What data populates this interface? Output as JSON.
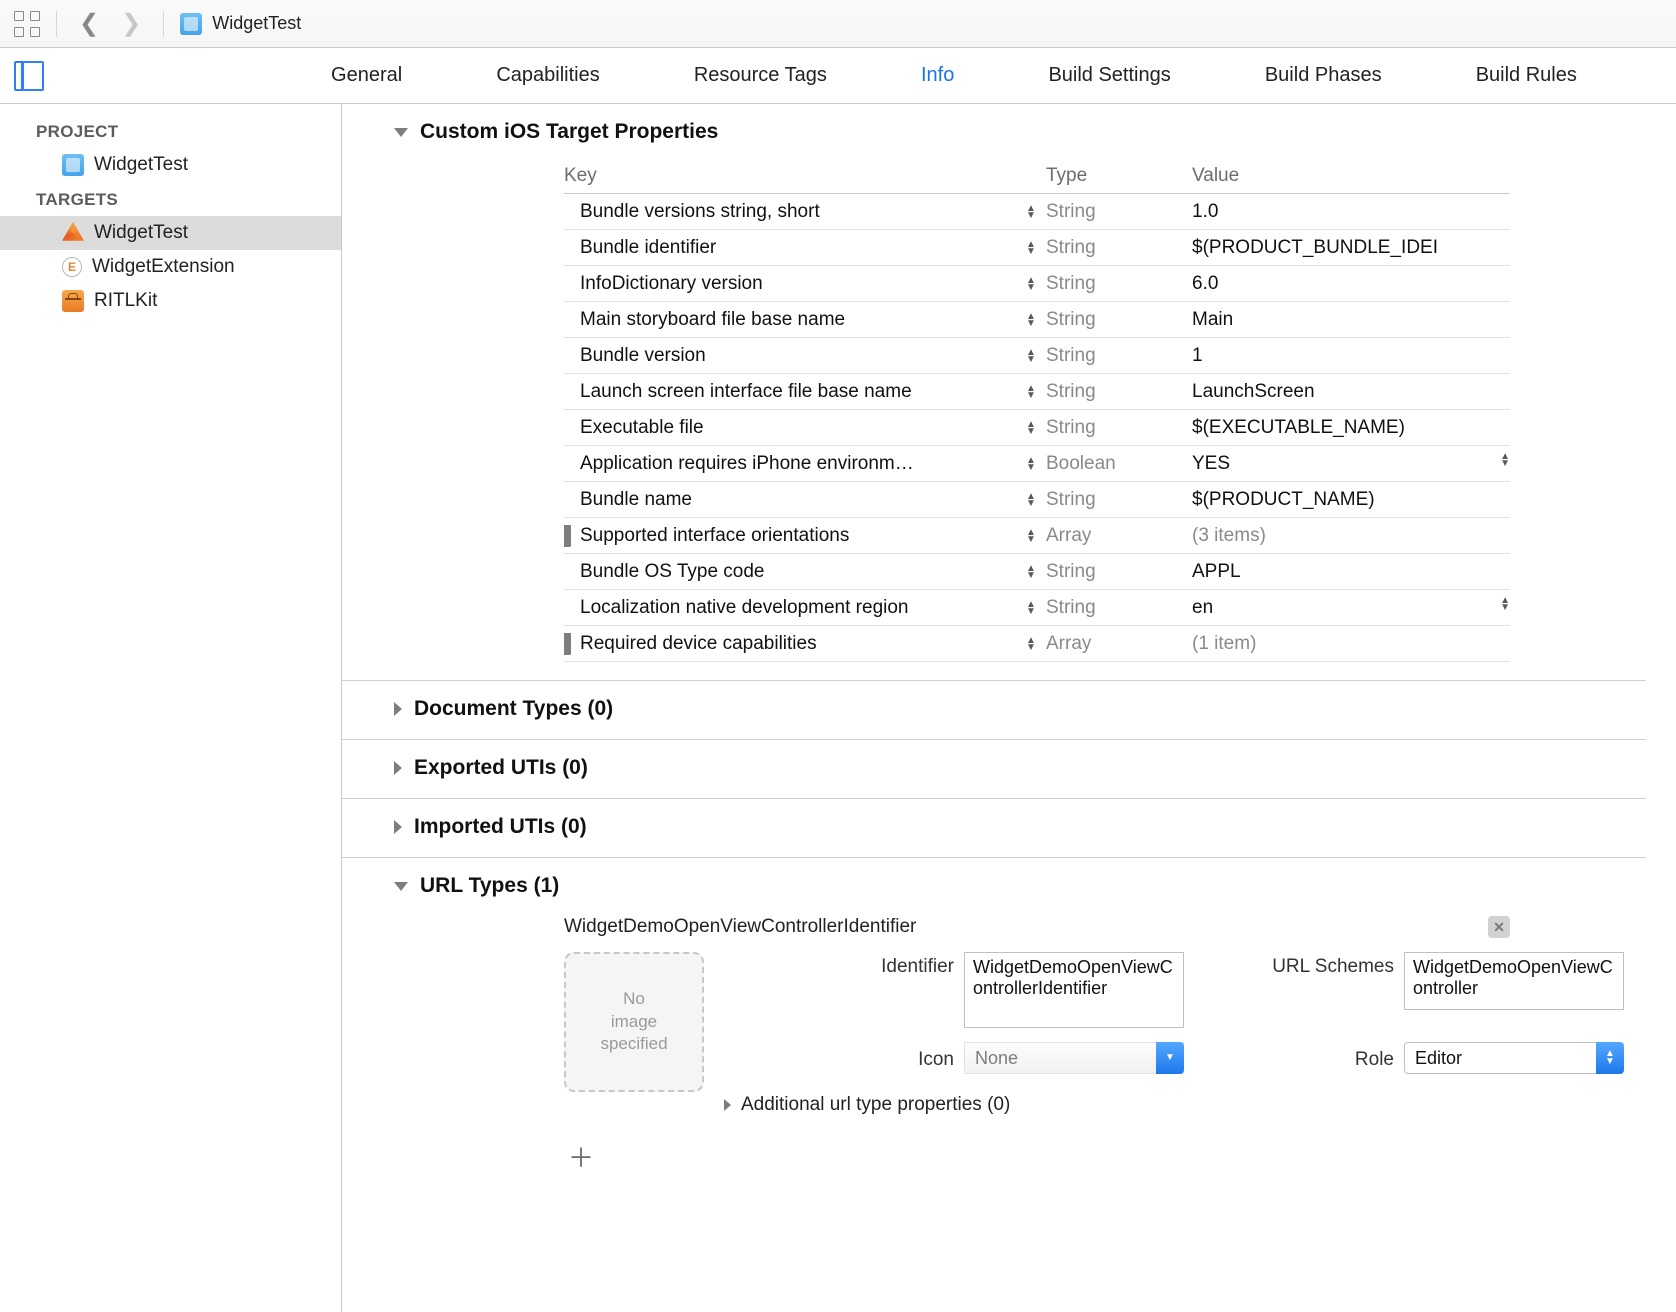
{
  "breadcrumb": {
    "project": "WidgetTest"
  },
  "sidebar": {
    "project_label": "PROJECT",
    "targets_label": "TARGETS",
    "project": "WidgetTest",
    "targets": [
      {
        "name": "WidgetTest"
      },
      {
        "name": "WidgetExtension"
      },
      {
        "name": "RITLKit"
      }
    ]
  },
  "tabs": {
    "general": "General",
    "capabilities": "Capabilities",
    "resource_tags": "Resource Tags",
    "info": "Info",
    "build_settings": "Build Settings",
    "build_phases": "Build Phases",
    "build_rules": "Build Rules"
  },
  "sections": {
    "custom_props": "Custom iOS Target Properties",
    "document_types": "Document Types (0)",
    "exported_utis": "Exported UTIs (0)",
    "imported_utis": "Imported UTIs (0)",
    "url_types": "URL Types (1)"
  },
  "plist": {
    "header": {
      "key": "Key",
      "type": "Type",
      "value": "Value"
    },
    "rows": [
      {
        "key": "Bundle versions string, short",
        "type": "String",
        "value": "1.0"
      },
      {
        "key": "Bundle identifier",
        "type": "String",
        "value": "$(PRODUCT_BUNDLE_IDEI"
      },
      {
        "key": "InfoDictionary version",
        "type": "String",
        "value": "6.0"
      },
      {
        "key": "Main storyboard file base name",
        "type": "String",
        "value": "Main"
      },
      {
        "key": "Bundle version",
        "type": "String",
        "value": "1"
      },
      {
        "key": "Launch screen interface file base name",
        "type": "String",
        "value": "LaunchScreen"
      },
      {
        "key": "Executable file",
        "type": "String",
        "value": "$(EXECUTABLE_NAME)"
      },
      {
        "key": "Application requires iPhone environm…",
        "type": "Boolean",
        "value": "YES",
        "trail": true
      },
      {
        "key": "Bundle name",
        "type": "String",
        "value": "$(PRODUCT_NAME)"
      },
      {
        "key": "Supported interface orientations",
        "type": "Array",
        "value": "(3 items)",
        "expandable": true,
        "dim": true
      },
      {
        "key": "Bundle OS Type code",
        "type": "String",
        "value": "APPL"
      },
      {
        "key": "Localization native development region",
        "type": "String",
        "value": "en",
        "trail": true
      },
      {
        "key": "Required device capabilities",
        "type": "Array",
        "value": "(1 item)",
        "expandable": true,
        "dim": true
      }
    ]
  },
  "url_type": {
    "title": "WidgetDemoOpenViewControllerIdentifier",
    "no_image": "No\nimage\nspecified",
    "identifier_label": "Identifier",
    "identifier_value": "WidgetDemoOpenViewControllerIdentifier",
    "icon_label": "Icon",
    "icon_value": "None",
    "schemes_label": "URL Schemes",
    "schemes_value": "WidgetDemoOpenViewController",
    "role_label": "Role",
    "role_value": "Editor",
    "additional": "Additional url type properties (0)"
  }
}
